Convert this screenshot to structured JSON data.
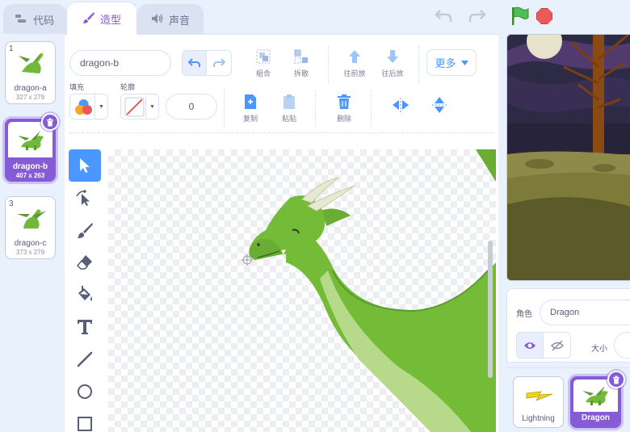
{
  "tabs": [
    {
      "label": "代码",
      "icon": "code-icon"
    },
    {
      "label": "造型",
      "icon": "brush-icon"
    },
    {
      "label": "声音",
      "icon": "speaker-icon"
    }
  ],
  "costumes": [
    {
      "number": "1",
      "name": "dragon-a",
      "size": "327 x 279"
    },
    {
      "number": "2",
      "name": "dragon-b",
      "size": "407 x 263"
    },
    {
      "number": "3",
      "name": "dragon-c",
      "size": "373 x 279"
    }
  ],
  "editor": {
    "costume_name": "dragon-b",
    "group_label": "組合",
    "ungroup_label": "拆散",
    "forward_label": "往前放",
    "backward_label": "往后放",
    "more_label": "更多",
    "fill_label": "填充",
    "outline_label": "轮廓",
    "outline_width": "0",
    "copy_label": "复制",
    "paste_label": "粘贴",
    "delete_label": "删除"
  },
  "sprite_info": {
    "sprite_label": "角色",
    "sprite_name": "Dragon",
    "size_label": "大小"
  },
  "sprites": [
    {
      "name": "Lightning"
    },
    {
      "name": "Dragon"
    }
  ],
  "colors": {
    "accent": "#855cd6",
    "blue": "#4c97ff",
    "dragon_green": "#72b93a"
  }
}
